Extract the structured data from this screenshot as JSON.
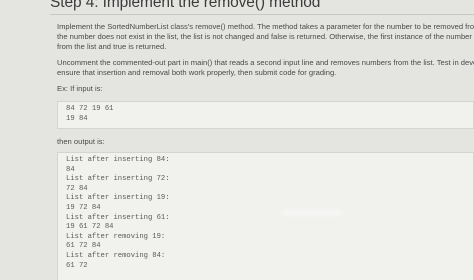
{
  "title": "Step 4: Implement the remove() method",
  "instructions": {
    "lines": [
      "Implement the SortedNumberList class's remove() method. The method takes a parameter for the number to be removed from the li",
      "the number does not exist in the list, the list is not changed and false is returned. Otherwise, the first instance of the number is remov",
      "from the list and true is returned."
    ]
  },
  "uncomment": {
    "lines": [
      "Uncomment the commented-out part in main() that reads a second input line and removes numbers from the list. Test in develop mo",
      "ensure that insertion and removal both work properly, then submit code for grading."
    ]
  },
  "example_label": "Ex: If input is:",
  "input_lines": [
    "84 72 19 61",
    "19 84"
  ],
  "output_label": "then output is:",
  "output_lines": [
    "List after inserting 84:",
    "84",
    "List after inserting 72:",
    "72 84",
    "List after inserting 19:",
    "19 72 84",
    "List after inserting 61:",
    "19 61 72 84",
    "List after removing 19:",
    "61 72 84",
    "List after removing 84:",
    "61 72"
  ]
}
